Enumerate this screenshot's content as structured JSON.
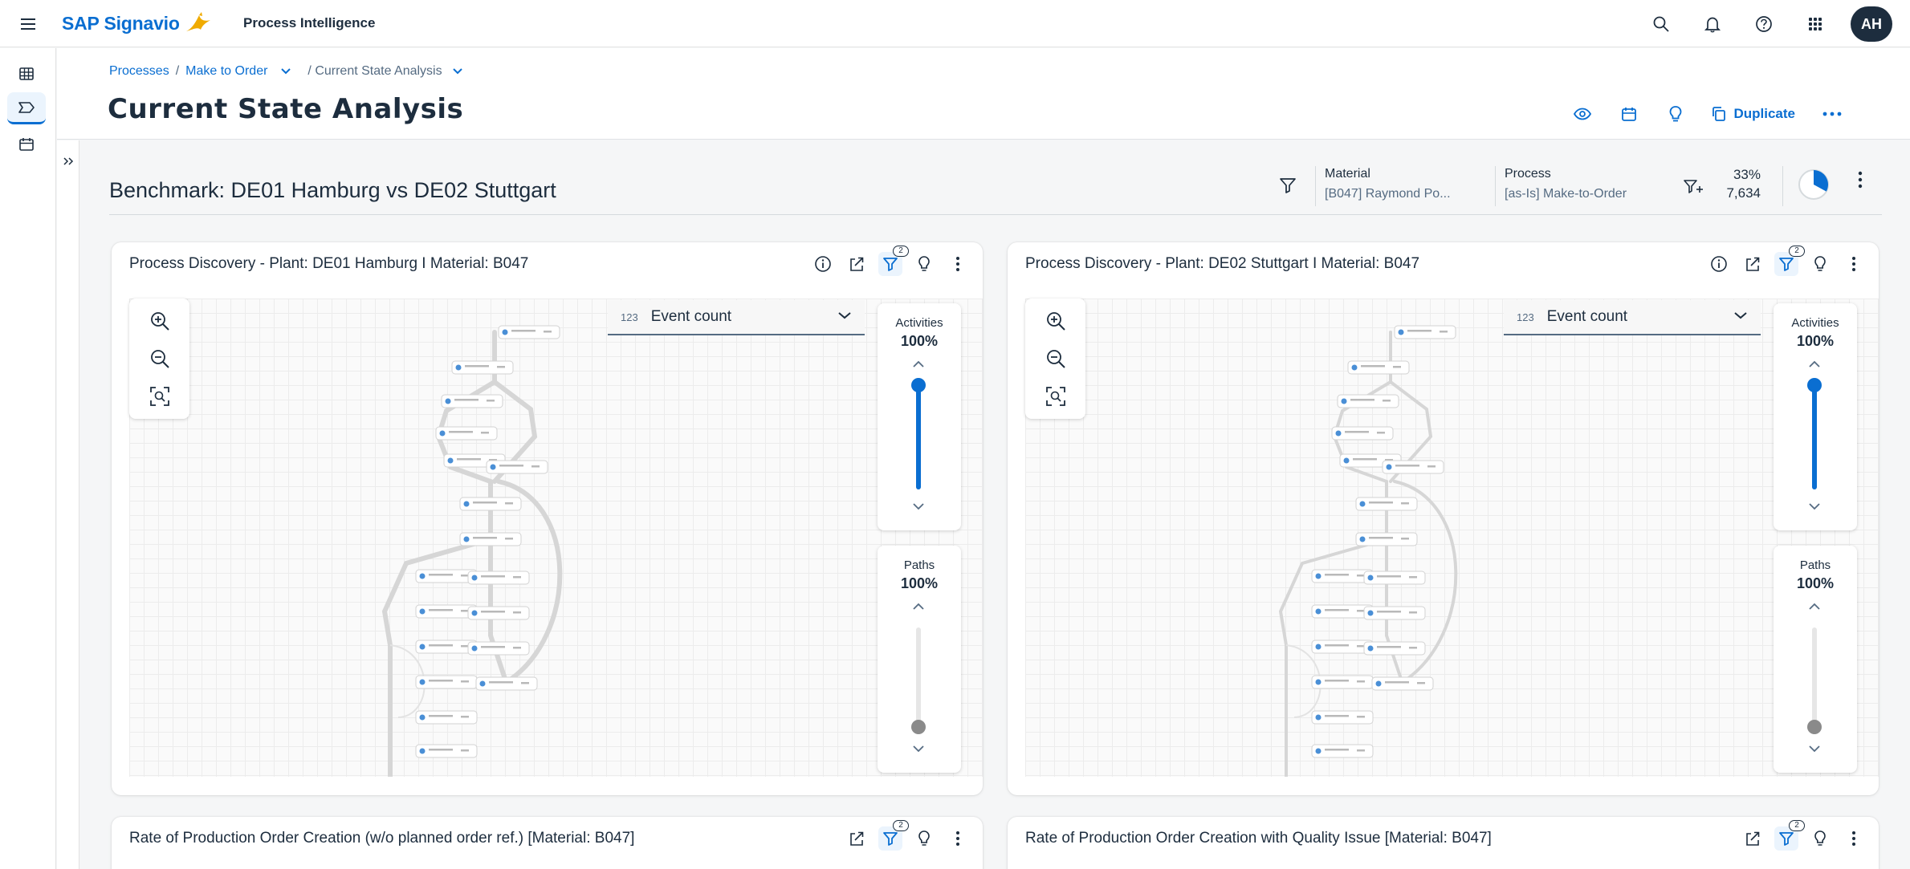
{
  "shell": {
    "brand": "SAP Signavio",
    "product": "Process Intelligence",
    "avatar_initials": "AH",
    "icons": [
      "menu-icon",
      "search-icon",
      "bell-icon",
      "help-icon",
      "grid-icon"
    ],
    "brand_color": "#0a6ed1",
    "logo_color": "#f0ab00"
  },
  "nav": {
    "items": [
      "table-icon",
      "process-icon",
      "calendar-icon"
    ],
    "active_index": 1
  },
  "breadcrumb": {
    "processes": "Processes",
    "sep": "/",
    "process": "Make to Order",
    "current": "/ Current State Analysis"
  },
  "page": {
    "title": "Current State Analysis",
    "duplicate_label": "Duplicate"
  },
  "benchmark": {
    "title": "Benchmark: DE01 Hamburg vs DE02 Stuttgart",
    "material_label": "Material",
    "material_value": "[B047] Raymond Po...",
    "process_label": "Process",
    "process_value": "[as-Is] Make-to-Order",
    "percent": "33%",
    "count": "7,634",
    "pie_fraction": 0.33
  },
  "cards": [
    {
      "title": "Process Discovery - Plant: DE01 Hamburg I Material: B047",
      "filter_badge": "2",
      "metric_num": "123",
      "metric": "Event count",
      "activities_label": "Activities",
      "activities_value": "100%",
      "activities_level": 1.0,
      "paths_label": "Paths",
      "paths_value": "100%",
      "paths_level": 0.0
    },
    {
      "title": "Process Discovery - Plant: DE02 Stuttgart I Material: B047",
      "filter_badge": "2",
      "metric_num": "123",
      "metric": "Event count",
      "activities_label": "Activities",
      "activities_value": "100%",
      "activities_level": 1.0,
      "paths_label": "Paths",
      "paths_value": "100%",
      "paths_level": 0.0
    }
  ],
  "bottom_cards": [
    {
      "title": "Rate of Production Order Creation (w/o planned order ref.) [Material: B047]",
      "filter_badge": "2"
    },
    {
      "title": "Rate of Production Order Creation with Quality Issue [Material: B047]",
      "filter_badge": "2"
    }
  ]
}
